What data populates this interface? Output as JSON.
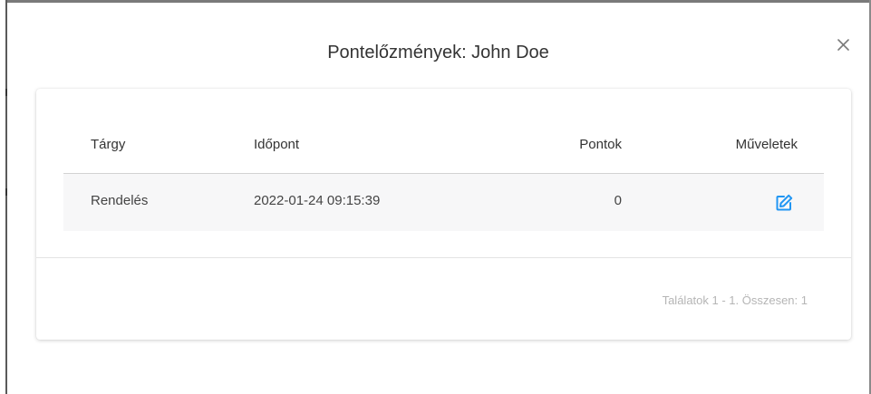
{
  "modal": {
    "title": "Pontelőzmények: John Doe",
    "close_icon": "close-icon"
  },
  "table": {
    "headers": {
      "subject": "Tárgy",
      "time": "Időpont",
      "points": "Pontok",
      "actions": "Műveletek"
    },
    "rows": [
      {
        "subject": "Rendelés",
        "time": "2022-01-24 09:15:39",
        "points": "0",
        "action_icon": "edit-icon"
      }
    ]
  },
  "pagination": {
    "info": "Találatok 1 - 1. Összesen: 1"
  },
  "colors": {
    "accent": "#2196f3",
    "row_background": "#f7f7f8",
    "muted_text": "#b5b5b5"
  }
}
